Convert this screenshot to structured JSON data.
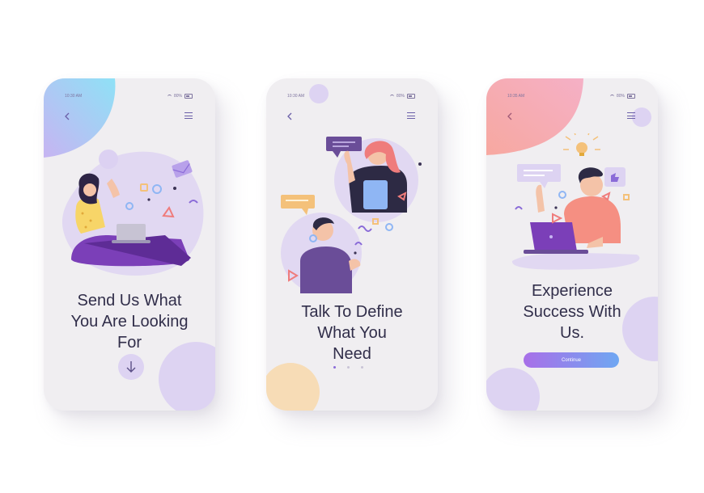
{
  "screens": [
    {
      "status": {
        "time": "10:30 AM",
        "battery": "80%"
      },
      "headline": [
        "Send Us What",
        "You Are Looking",
        "For"
      ]
    },
    {
      "status": {
        "time": "10:30 AM",
        "battery": "80%"
      },
      "headline": [
        "Talk To Define",
        "What You",
        "Need"
      ]
    },
    {
      "status": {
        "time": "10:35 AM",
        "battery": "80%"
      },
      "headline": [
        "Experience",
        "Success With",
        "Us."
      ],
      "button": "Continue"
    }
  ],
  "colors": {
    "phone_bg": "#f0eef1",
    "text": "#312e4a",
    "accent_purple": "#8a6bd8",
    "lavender": "#ddd3f2",
    "button_gradient_start": "#a86fe8",
    "button_gradient_end": "#6fa7f2"
  },
  "icons": [
    "back-chevron-icon",
    "menu-icon",
    "wifi-icon",
    "battery-icon",
    "down-arrow-icon"
  ]
}
